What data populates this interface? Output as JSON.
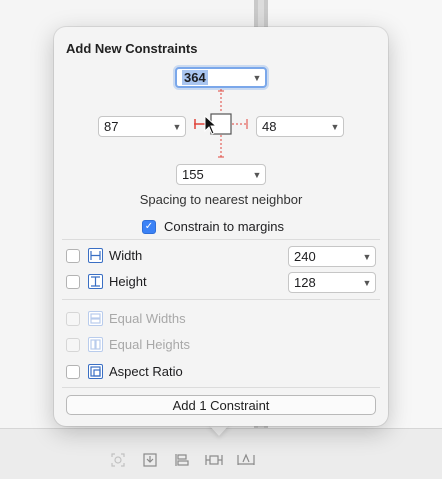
{
  "popover": {
    "title": "Add New Constraints",
    "top_value": "364",
    "left_value": "87",
    "right_value": "48",
    "bottom_value": "155",
    "spacing_label": "Spacing to nearest neighbor",
    "constrain_margins": {
      "label": "Constrain to margins",
      "checked": true
    },
    "rows": [
      {
        "label": "Width",
        "value": "240",
        "icon": "width-icon",
        "enabled": true
      },
      {
        "label": "Height",
        "value": "128",
        "icon": "height-icon",
        "enabled": true
      },
      {
        "label": "Equal Widths",
        "icon": "equal-widths-icon",
        "enabled": false
      },
      {
        "label": "Equal Heights",
        "icon": "equal-heights-icon",
        "enabled": false
      },
      {
        "label": "Aspect Ratio",
        "icon": "aspect-ratio-icon",
        "enabled": true
      }
    ],
    "add_button": "Add 1 Constraint"
  },
  "colors": {
    "accent": "#3b82f6",
    "constraint_strut": "#e0453b"
  }
}
